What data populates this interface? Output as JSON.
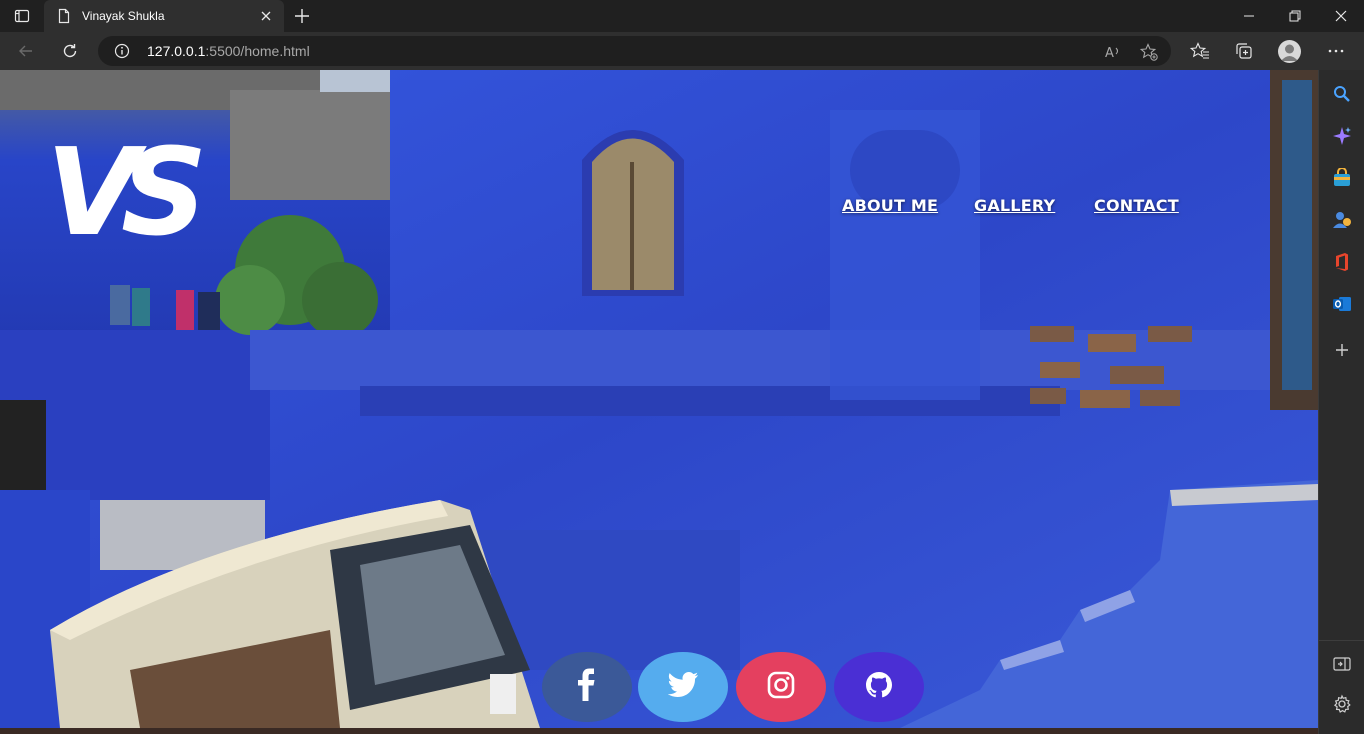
{
  "browser": {
    "tab_title": "Vinayak Shukla",
    "url_host": "127.0.0.1",
    "url_path": ":5500/home.html"
  },
  "page": {
    "logo_text": "VS",
    "nav": [
      {
        "label": "ABOUT ME"
      },
      {
        "label": "GALLERY"
      },
      {
        "label": "CONTACT"
      }
    ],
    "social": [
      {
        "name": "facebook",
        "color": "#3b5998"
      },
      {
        "name": "twitter",
        "color": "#55acee"
      },
      {
        "name": "instagram",
        "color": "#e4405f"
      },
      {
        "name": "github",
        "color": "#4a2fd4"
      }
    ]
  },
  "colors": {
    "chrome_dark": "#202020",
    "chrome_toolbar": "#2f2f2f",
    "wall_blue": "#2f4fd0"
  }
}
